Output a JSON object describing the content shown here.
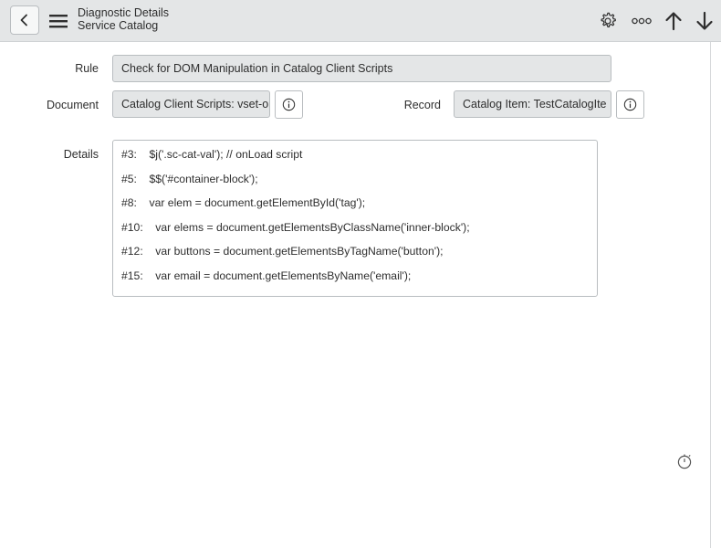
{
  "header": {
    "title": "Diagnostic Details",
    "subtitle": "Service Catalog",
    "icons": [
      "back-icon",
      "menu-icon",
      "gear-icon",
      "more-icon",
      "arrow-up-icon",
      "arrow-down-icon"
    ]
  },
  "form": {
    "rule_label": "Rule",
    "rule_value": "Check for DOM Manipulation in Catalog Client Scripts",
    "document_label": "Document",
    "document_value": "Catalog Client Scripts: vset-o",
    "record_label": "Record",
    "record_value": "Catalog Item: TestCatalogIte",
    "details_label": "Details",
    "details_lines": [
      "#3:    $j('.sc-cat-val'); // onLoad script",
      "#5:    $$('#container-block');",
      "#8:    var elem = document.getElementById('tag');",
      "#10:    var elems = document.getElementsByClassName('inner-block');",
      "#12:    var buttons = document.getElementsByTagName('button');",
      "#15:    var email = document.getElementsByName('email');"
    ]
  },
  "colors": {
    "header_bg": "#e4e6e7",
    "field_bg": "#e4e6e7",
    "border": "#b9bdc0",
    "text": "#2e2e2e"
  }
}
